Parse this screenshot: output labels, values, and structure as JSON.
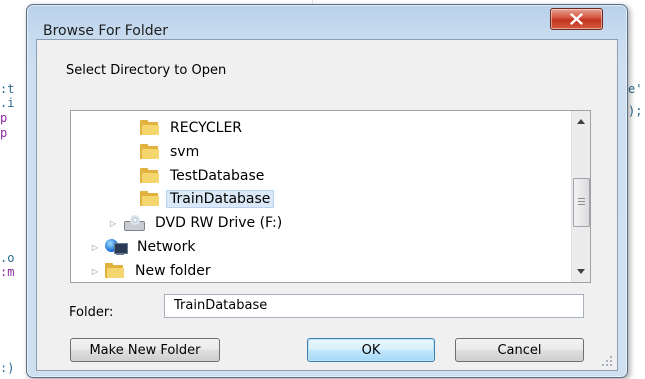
{
  "dialog": {
    "title": "Browse For Folder",
    "prompt": "Select Directory to Open",
    "tree": [
      {
        "label": "RECYCLER",
        "icon": "folder-icon",
        "selected": false,
        "expander": false
      },
      {
        "label": "svm",
        "icon": "folder-icon",
        "selected": false,
        "expander": false
      },
      {
        "label": "TestDatabase",
        "icon": "folder-icon",
        "selected": false,
        "expander": false
      },
      {
        "label": "TrainDatabase",
        "icon": "folder-icon",
        "selected": true,
        "expander": false
      },
      {
        "label": "DVD RW Drive (F:)",
        "icon": "dvd-drive-icon",
        "selected": false,
        "expander": true
      },
      {
        "label": "Network",
        "icon": "network-icon",
        "selected": false,
        "expander": true
      },
      {
        "label": "New folder",
        "icon": "folder-icon",
        "selected": false,
        "expander": true
      }
    ],
    "folder_label": "Folder:",
    "folder_value": "TrainDatabase",
    "buttons": {
      "make_new_folder": "Make New Folder",
      "ok": "OK",
      "cancel": "Cancel"
    }
  },
  "background_code": {
    "left": [
      ":t",
      ".i",
      "p",
      "p",
      ".o",
      ":m",
      ":)"
    ],
    "right": [
      "e'",
      ");"
    ]
  },
  "colors": {
    "title_bar": "#b9d1ea",
    "close_button": "#c7402a",
    "selection": "#dbe8f7",
    "ok_button": "#bee6fd"
  }
}
